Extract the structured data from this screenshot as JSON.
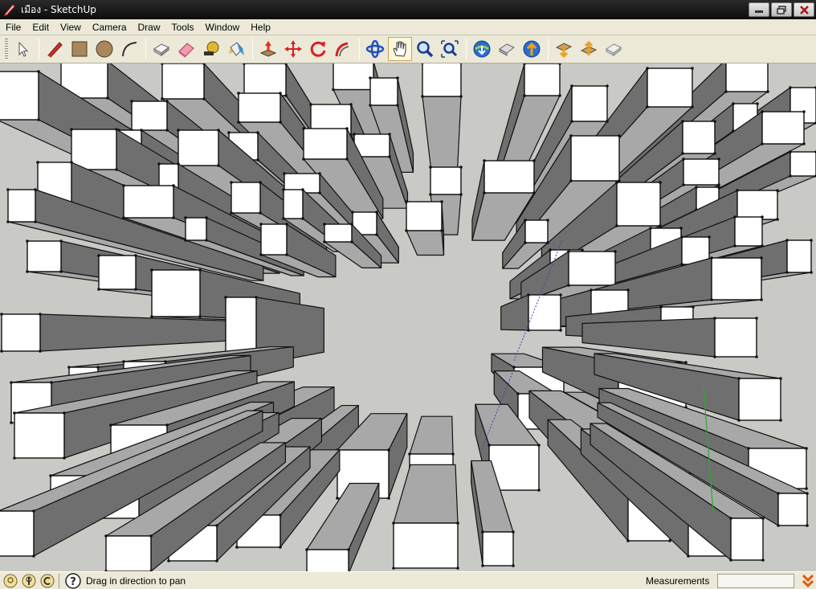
{
  "window": {
    "title": "เมือง - SketchUp",
    "controls": [
      "minimize",
      "restore",
      "close"
    ]
  },
  "menu": [
    "File",
    "Edit",
    "View",
    "Camera",
    "Draw",
    "Tools",
    "Window",
    "Help"
  ],
  "toolbar": {
    "tools": [
      "select-icon",
      "pencil-line-icon",
      "rectangle-icon",
      "circle-icon",
      "arc-icon",
      "make-component-icon",
      "eraser-icon",
      "tape-measure-icon",
      "paint-bucket-icon",
      "push-pull-icon",
      "move-icon",
      "rotate-icon",
      "follow-me-icon",
      "orbit-icon",
      "pan-icon",
      "zoom-icon",
      "zoom-extents-icon",
      "get-models-icon",
      "share-model-icon",
      "upload-icon",
      "get-components-icon",
      "share-component-icon",
      "extension-icon"
    ],
    "active_tool": "pan-icon"
  },
  "status": {
    "hint": "Drag in direction to pan",
    "measurements_label": "Measurements",
    "measurements_value": ""
  },
  "colors": {
    "ground": "#c9c9c5",
    "roof": "#ffffff",
    "wall_light": "#a8a8a8",
    "wall_dark": "#6f6f6f",
    "axis_green": "#2fa82f",
    "axis_blue": "#3048b0"
  }
}
